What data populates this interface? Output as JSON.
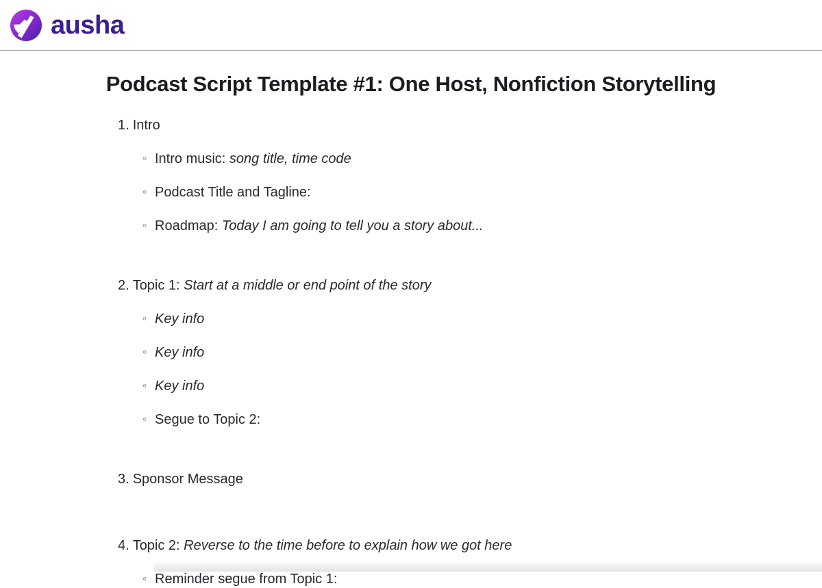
{
  "header": {
    "brand_name": "ausha",
    "logo_icon": "ausha-wave-logo-icon",
    "logo_gradient_from": "#a42fd4",
    "logo_gradient_to": "#4a1fa8",
    "wordmark_color": "#3b1e91",
    "divider_color": "#9b92a8"
  },
  "document": {
    "title": "Podcast Script Template #1: One Host, Nonfiction Storytelling",
    "title_color": "#1c1c20",
    "body_text_color": "#2a2a2e",
    "bullet_marker": "◦",
    "sections": [
      {
        "number": "1.",
        "label": "Intro",
        "emphasis": "",
        "subitems": [
          {
            "label": "Intro music: ",
            "emphasis": "song title, time code"
          },
          {
            "label": "Podcast Title and Tagline:",
            "emphasis": ""
          },
          {
            "label": "Roadmap: ",
            "emphasis": "Today I am going to tell you a story about..."
          }
        ]
      },
      {
        "number": "2.",
        "label": "Topic 1: ",
        "emphasis": "Start at a middle or end point of the story",
        "subitems": [
          {
            "label": "",
            "emphasis": "Key info"
          },
          {
            "label": "",
            "emphasis": "Key info"
          },
          {
            "label": "",
            "emphasis": "Key info"
          },
          {
            "label": "Segue to Topic 2:",
            "emphasis": ""
          }
        ]
      },
      {
        "number": "3.",
        "label": "Sponsor Message",
        "emphasis": "",
        "subitems": []
      },
      {
        "number": "4.",
        "label": "Topic 2: ",
        "emphasis": "Reverse to the time before to explain how we got here",
        "subitems": [
          {
            "label": "Reminder segue from Topic 1:",
            "emphasis": ""
          }
        ]
      }
    ]
  }
}
